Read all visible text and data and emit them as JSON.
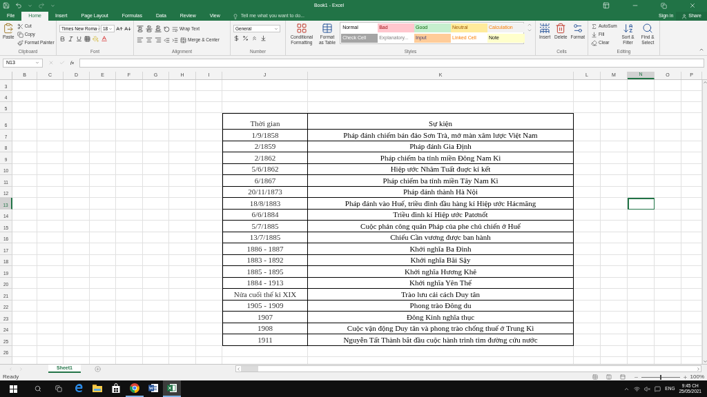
{
  "title_bar": {
    "title": "Book1 - Excel",
    "sign_in": "Sign in",
    "share": "Share"
  },
  "tabs": [
    {
      "label": "File",
      "selected": false
    },
    {
      "label": "Home",
      "selected": true
    },
    {
      "label": "Insert",
      "selected": false
    },
    {
      "label": "Page Layout",
      "selected": false
    },
    {
      "label": "Formulas",
      "selected": false
    },
    {
      "label": "Data",
      "selected": false
    },
    {
      "label": "Review",
      "selected": false
    },
    {
      "label": "View",
      "selected": false
    }
  ],
  "tell_me": {
    "placeholder": "Tell me what you want to do..."
  },
  "clipboard": {
    "paste": "Paste",
    "cut": "Cut",
    "copy": "Copy",
    "format_painter": "Format Painter",
    "label": "Clipboard"
  },
  "font": {
    "font_name": "Times New Roma",
    "font_size": "18",
    "label": "Font"
  },
  "alignment": {
    "wrap_text": "Wrap Text",
    "merge": "Merge & Center",
    "label": "Alignment"
  },
  "number": {
    "format": "General",
    "label": "Number"
  },
  "styles": {
    "conditional": "Conditional Formatting",
    "format_table": "Format as Table",
    "label": "Styles",
    "cells": [
      {
        "label": "Normal",
        "color": "#ffffff"
      },
      {
        "label": "Bad",
        "color": "#ffc7ce"
      },
      {
        "label": "Good",
        "color": "#c6efce"
      },
      {
        "label": "Neutral",
        "color": "#ffeb9c"
      },
      {
        "label": "Calculation",
        "color": "#f2f2f2"
      },
      {
        "label": "Check Cell",
        "color": "#a5a5a5"
      },
      {
        "label": "Explanatory...",
        "color": "#ffffff"
      },
      {
        "label": "Input",
        "color": "#ffcc99"
      },
      {
        "label": "Linked Cell",
        "color": "#ffffff"
      },
      {
        "label": "Note",
        "color": "#ffffcc"
      }
    ]
  },
  "cells_group": {
    "insert": "Insert",
    "delete": "Delete",
    "format": "Format",
    "label": "Cells"
  },
  "editing": {
    "autosum": "AutoSum",
    "fill": "Fill",
    "clear": "Clear",
    "sort": "Sort & Filter",
    "find": "Find & Select",
    "label": "Editing"
  },
  "formula_bar": {
    "name_box": "N13",
    "fx": "fx"
  },
  "columns": [
    {
      "label": "B",
      "selected": false
    },
    {
      "label": "C",
      "selected": false
    },
    {
      "label": "D",
      "selected": false
    },
    {
      "label": "E",
      "selected": false
    },
    {
      "label": "F",
      "selected": false
    },
    {
      "label": "G",
      "selected": false
    },
    {
      "label": "H",
      "selected": false
    },
    {
      "label": "I",
      "selected": false
    },
    {
      "label": "J",
      "selected": false
    },
    {
      "label": "K",
      "selected": false
    },
    {
      "label": "L",
      "selected": false
    },
    {
      "label": "M",
      "selected": false
    },
    {
      "label": "N",
      "selected": true
    },
    {
      "label": "O",
      "selected": false
    },
    {
      "label": "P",
      "selected": false
    }
  ],
  "rows": [
    {
      "label": "3",
      "selected": false
    },
    {
      "label": "4",
      "selected": false
    },
    {
      "label": "5",
      "selected": false
    },
    {
      "label": "6",
      "selected": false
    },
    {
      "label": "7",
      "selected": false
    },
    {
      "label": "8",
      "selected": false
    },
    {
      "label": "9",
      "selected": false
    },
    {
      "label": "10",
      "selected": false
    },
    {
      "label": "11",
      "selected": false
    },
    {
      "label": "12",
      "selected": false
    },
    {
      "label": "13",
      "selected": true
    },
    {
      "label": "14",
      "selected": false
    },
    {
      "label": "15",
      "selected": false
    },
    {
      "label": "16",
      "selected": false
    },
    {
      "label": "17",
      "selected": false
    },
    {
      "label": "18",
      "selected": false
    },
    {
      "label": "19",
      "selected": false
    },
    {
      "label": "20",
      "selected": false
    },
    {
      "label": "21",
      "selected": false
    },
    {
      "label": "22",
      "selected": false
    },
    {
      "label": "23",
      "selected": false
    },
    {
      "label": "24",
      "selected": false
    },
    {
      "label": "25",
      "selected": false
    },
    {
      "label": "26",
      "selected": false
    }
  ],
  "table": {
    "header": [
      "Thời gian",
      "Sự kiện"
    ],
    "rows": [
      [
        "1/9/1858",
        "Pháp đánh chiếm bán đảo Sơn Trà, mở màn xâm lược Việt Nam"
      ],
      [
        "2/1859",
        "Pháp đánh Gia Định"
      ],
      [
        "2/1862",
        "Pháp chiếm ba tỉnh miền Đông Nam Kì"
      ],
      [
        "5/6/1862",
        "Hiệp ước Nhâm Tuất đuợc kí kết"
      ],
      [
        "6/1867",
        "Pháp chiếm ba tỉnh miền Tây Nam Kì"
      ],
      [
        "20/11/1873",
        "Pháp đánh thành Hà Nội"
      ],
      [
        "18/8/1883",
        "Pháp đánh vào Huế, triều đình đầu hàng kí Hiệp ước Hácmăng"
      ],
      [
        "6/6/1884",
        "Triều đình kí Hiệp ước Patơnốt"
      ],
      [
        "5/7/1885",
        "Cuộc phản công quân Pháp của phe chủ chiến ở Huế"
      ],
      [
        "13/7/1885",
        "Chiếu Cần vương được ban hành"
      ],
      [
        "1886 - 1887",
        "Khởi nghĩa Ba Đình"
      ],
      [
        "1883 - 1892",
        "Khởi nghĩa Bãi Sậy"
      ],
      [
        "1885 - 1895",
        "Khởi nghĩa Hương Khê"
      ],
      [
        "1884 - 1913",
        "Khởi nghĩa Yên Thế"
      ],
      [
        "Nửa cuối thế kỉ XIX",
        "Trào lưu cải cách Duy tân"
      ],
      [
        "1905 - 1909",
        "Phong trào Đông du"
      ],
      [
        "1907",
        "Đông Kinh nghĩa thục"
      ],
      [
        "1908",
        "Cuộc vận động Duy tân và phong trào chống thuế ở Trung Kì"
      ],
      [
        "1911",
        "Nguyễn Tất Thành bắt đầu cuộc hành trình tìm đường cứu nước"
      ]
    ]
  },
  "sheet_tabs": [
    {
      "label": "Sheet1",
      "selected": true
    }
  ],
  "status_bar": {
    "status": "Ready",
    "zoom": "100%",
    "level": 0.5
  },
  "taskbar": {
    "apps": [
      {
        "kind": "edge",
        "selected": false,
        "running": false
      },
      {
        "kind": "explorer",
        "selected": false,
        "running": false
      },
      {
        "kind": "store",
        "selected": false,
        "running": false
      },
      {
        "kind": "chrome",
        "selected": false,
        "running": true
      },
      {
        "kind": "word",
        "selected": false,
        "running": false
      },
      {
        "kind": "excel",
        "selected": true,
        "running": true
      }
    ],
    "language": "ENG",
    "time": "9:45 CH",
    "date": "25/05/2021"
  }
}
